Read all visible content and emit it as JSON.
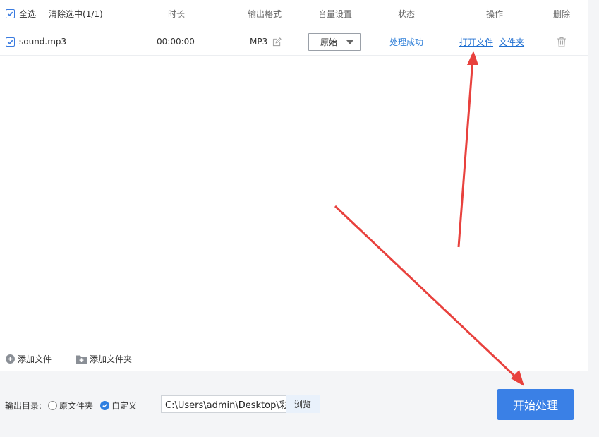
{
  "header": {
    "select_all": "全选",
    "clear_selection": "清除选中",
    "selection_count": "(1/1)",
    "col_duration": "时长",
    "col_format": "输出格式",
    "col_volume": "音量设置",
    "col_status": "状态",
    "col_actions": "操作",
    "col_delete": "删除"
  },
  "files": [
    {
      "name": "sound.mp3",
      "duration": "00:00:00",
      "format": "MP3",
      "volume": "原始",
      "status": "处理成功",
      "open_file": "打开文件",
      "open_folder": "文件夹"
    }
  ],
  "toolbar": {
    "add_file": "添加文件",
    "add_folder": "添加文件夹"
  },
  "output": {
    "label": "输出目录:",
    "option_original": "原文件夹",
    "option_custom": "自定义",
    "selected": "自定义",
    "path": "C:\\Users\\admin\\Desktop\\彩虹",
    "browse": "浏览"
  },
  "actions": {
    "start": "开始处理"
  },
  "colors": {
    "accent": "#3a80e6",
    "link": "#1f6fd1",
    "arrow": "#e8413d"
  }
}
